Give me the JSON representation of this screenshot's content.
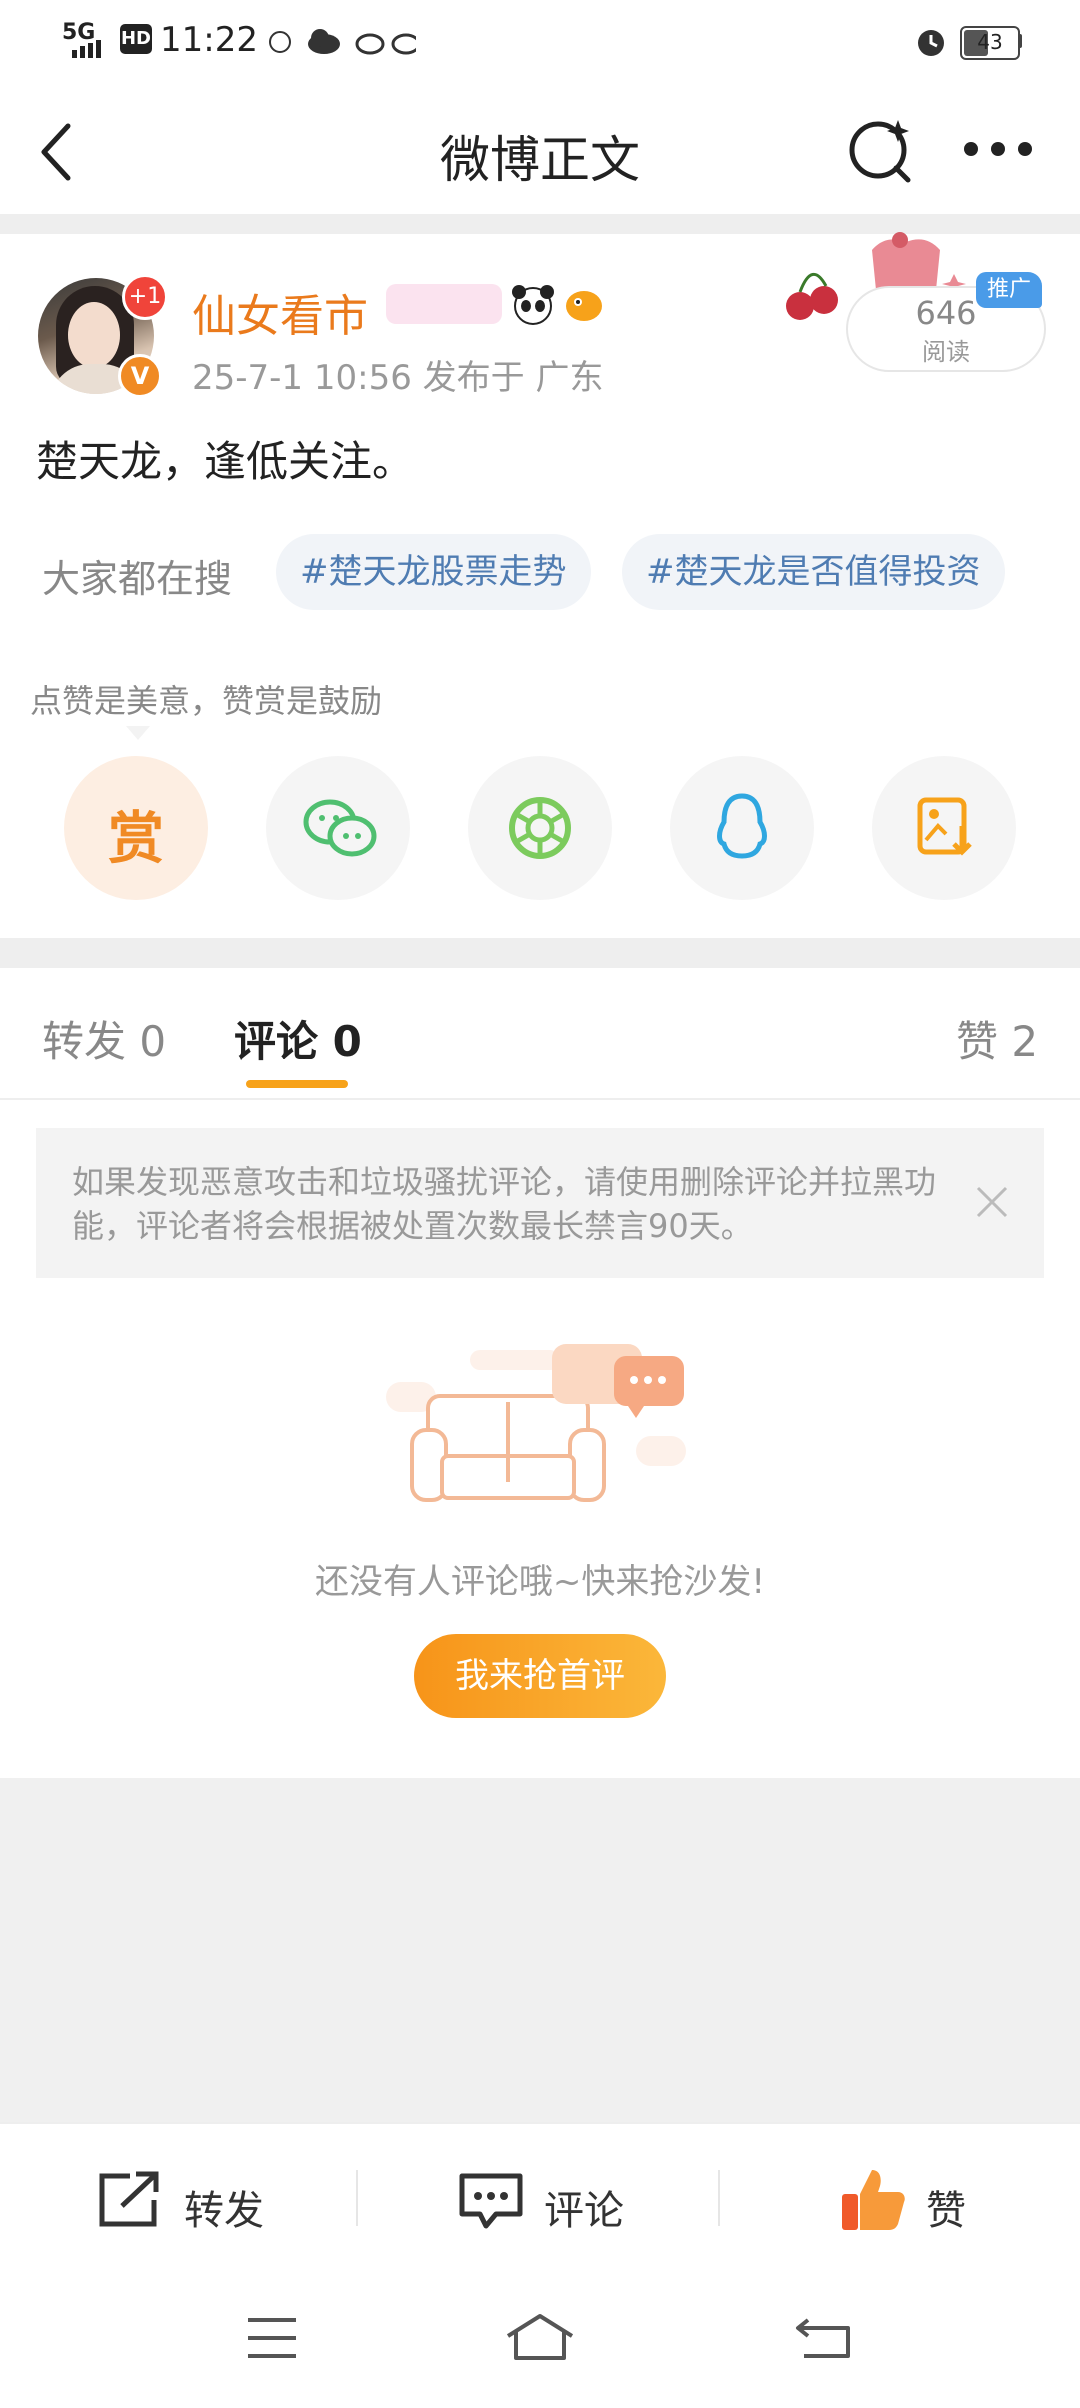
{
  "status_bar": {
    "network": "5G",
    "hd": "HD",
    "time": "11:22",
    "battery": "43"
  },
  "header": {
    "title": "微博正文",
    "back_icon": "back-arrow-icon",
    "search_icon": "search-icon",
    "more_icon": "more-icon"
  },
  "post": {
    "username": "仙女看市",
    "follow_badge": "+1",
    "verified_badge": "V",
    "meta": "25-7-1 10:56   发布于 广东",
    "content": "楚天龙，逢低关注。",
    "read_count": "646",
    "read_label": "阅读",
    "promo_label": "推广",
    "search_label": "大家都在搜",
    "search_chips": [
      "#楚天龙股票走势",
      "#楚天龙是否值得投资"
    ],
    "praise_hint": "点赞是美意，赞赏是鼓励",
    "reward_label": "赏",
    "share_icons": [
      "wechat-icon",
      "moments-icon",
      "qq-icon",
      "save-image-icon"
    ]
  },
  "tabs": {
    "repost": "转发 0",
    "comment": "评论 0",
    "like": "赞 2"
  },
  "notice": {
    "text": "如果发现恶意攻击和垃圾骚扰评论，请使用删除评论并拉黑功能，评论者将会根据被处置次数最长禁言90天。"
  },
  "empty": {
    "text": "还没有人评论哦~快来抢沙发!",
    "button": "我来抢首评"
  },
  "bottom_bar": {
    "repost": "转发",
    "comment": "评论",
    "like": "赞"
  },
  "colors": {
    "accent": "#f7a21a",
    "username": "#ea7a1c",
    "chip_text": "#4f7cb2"
  }
}
